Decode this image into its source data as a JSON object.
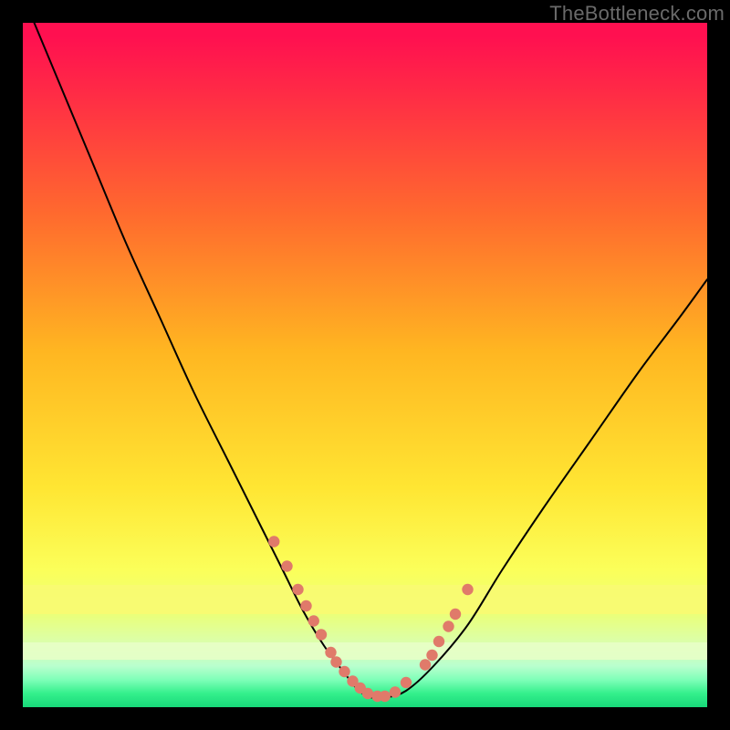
{
  "watermark": "TheBottleneck.com",
  "chart_data": {
    "type": "line",
    "title": "",
    "xlabel": "",
    "ylabel": "",
    "xlim": [
      0,
      100
    ],
    "ylim": [
      0,
      100
    ],
    "grid": false,
    "series": [
      {
        "name": "curve",
        "color": "#000000",
        "stroke_width": 2,
        "x": [
          0,
          5,
          10,
          15,
          20,
          25,
          30,
          35,
          38,
          41,
          44,
          47,
          49,
          51,
          53,
          56,
          60,
          65,
          70,
          76,
          83,
          90,
          96,
          100
        ],
        "y": [
          104,
          92,
          80,
          68,
          57,
          46,
          36,
          26,
          20,
          14,
          9,
          5,
          2.5,
          1.4,
          1.4,
          2.4,
          6,
          12,
          20,
          29,
          39,
          49,
          57,
          62.5
        ]
      },
      {
        "name": "dot-cluster",
        "color": "#e07a6a",
        "type": "scatter",
        "radius": 6.2,
        "x": [
          36.7,
          38.6,
          40.2,
          41.4,
          42.5,
          43.6,
          45.0,
          45.8,
          47.0,
          48.2,
          49.3,
          50.4,
          51.8,
          52.9,
          54.4,
          56.0,
          58.8,
          59.8,
          60.8,
          62.2,
          63.2,
          65.0
        ],
        "y": [
          24.2,
          20.6,
          17.2,
          14.8,
          12.6,
          10.6,
          8.0,
          6.6,
          5.2,
          3.8,
          2.8,
          2.0,
          1.6,
          1.6,
          2.2,
          3.6,
          6.2,
          7.6,
          9.6,
          11.8,
          13.6,
          17.2
        ]
      }
    ]
  }
}
